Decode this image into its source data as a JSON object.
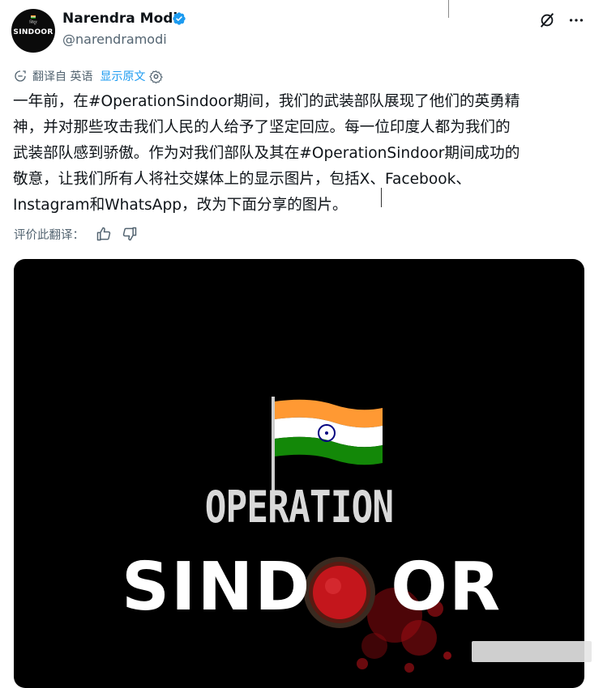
{
  "author": {
    "name": "Narendra Modi",
    "handle": "@narendramodi",
    "avatar_small": "सिंदूर",
    "avatar_big": "SINDOOR"
  },
  "icons": {
    "verified": "verified-badge-icon",
    "grok": "grok-icon",
    "more": "more-icon",
    "translate": "translate-icon",
    "settings": "gear-icon",
    "like": "thumbs-up-icon",
    "dislike": "thumbs-down-icon"
  },
  "translation": {
    "from": "翻译自 英语",
    "show_original": "显示原文",
    "rate": "评价此翻译："
  },
  "tweet_text": "一年前，在#OperationSindoor期间，我们的武装部队展现了他们的英勇精\n神，并对那些攻击我们人民的人给予了坚定回应。每一位印度人都为我们的\n武装部队感到骄傲。作为对我们部队及其在#OperationSindoor期间成功的\n敬意，让我们所有人将社交媒体上的显示图片，包括X、Facebook、\nInstagram和WhatsApp，改为下面分享的图片。",
  "image": {
    "line1": "OPERATION",
    "line2_part1": "SIND",
    "line2_part2": "OR"
  },
  "colors": {
    "accent": "#1d9bf0",
    "verified": "#1d9bf0",
    "saffron": "#ff9933",
    "green": "#138808",
    "chakra": "#000080",
    "sindoor_red": "#c4161c"
  }
}
